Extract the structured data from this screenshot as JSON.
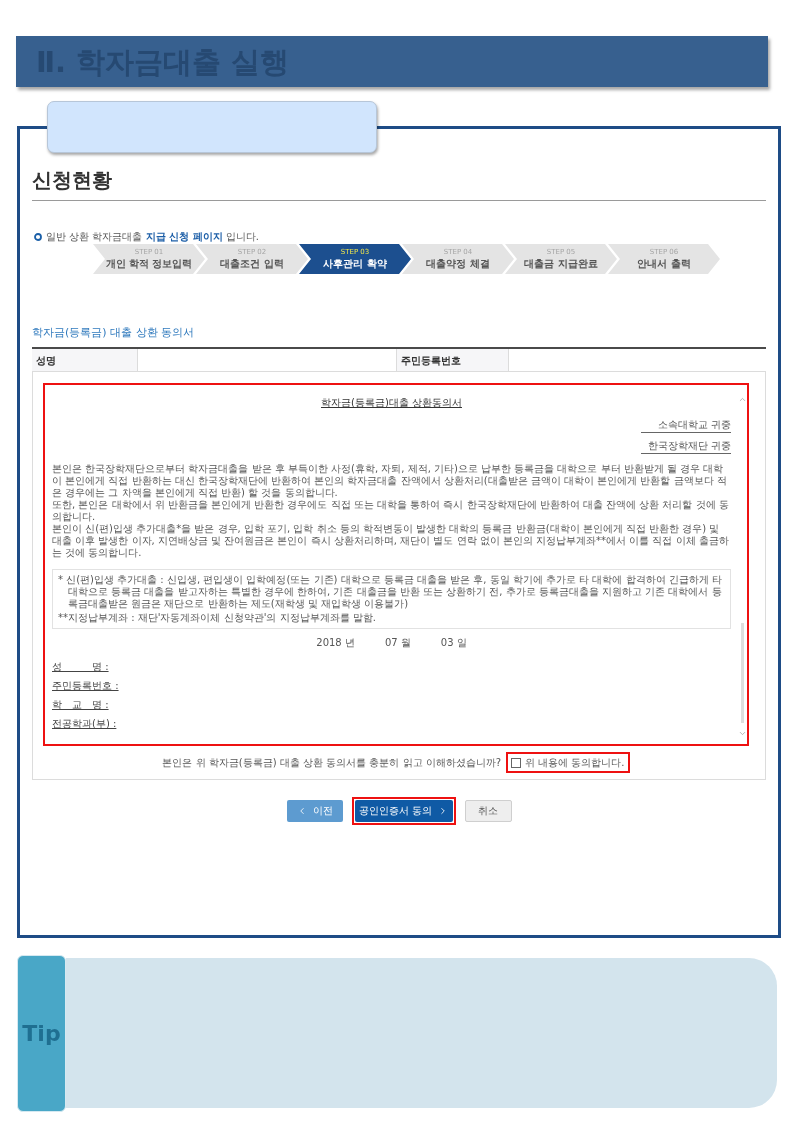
{
  "header": {
    "title": "Ⅱ. 학자금대출 실행"
  },
  "panel": {
    "heading": "신청현황",
    "notice": "일반 상환 학자금대출 **지급 신청 페이지** 입니다.",
    "steps": [
      {
        "step": "STEP 01",
        "label": "개인 학적 정보입력",
        "selected": false
      },
      {
        "step": "STEP 02",
        "label": "대출조건 입력",
        "selected": false
      },
      {
        "step": "STEP 03",
        "label": "사후관리 확약",
        "selected": true
      },
      {
        "step": "STEP 04",
        "label": "대출약정 체결",
        "selected": false
      },
      {
        "step": "STEP 05",
        "label": "대출금 지급완료",
        "selected": false
      },
      {
        "step": "STEP 06",
        "label": "안내서 출력",
        "selected": false
      }
    ],
    "section_title": "학자금(등록금) 대출 상환 동의서",
    "info_fields": [
      {
        "label": "성명"
      },
      {
        "label": "주민등록번호"
      }
    ],
    "document": {
      "highlighted": true,
      "title": "학자금(등록금)대출 상환동의서",
      "recipients": [
        "소속대학교 귀중",
        "한국장학재단 귀중"
      ],
      "paragraphs": [
        "본인은 한국장학재단으로부터 학자금대출을 받은 후 부득이한 사정(휴학, 자퇴, 제적, 기타)으로 납부한 등록금을 대학으로 부터 반환받게 될 경우 대학이 본인에게 직접 반환하는 대신 한국장학재단에 반환하여 본인의 학자금대출 잔액에서 상환처리(대출받은 금액이 대학이 본인에게 반환할 금액보다 적은 경우에는 그 차액을 본인에게 직접 반환) 할 것을 동의합니다.",
        "또한, 본인은 대학에서 위 반환금을 본인에게 반환한 경우에도 직접 또는 대학을 통하여 즉시 한국장학재단에 반환하여 대출 잔액에 상환 처리할 것에 동의합니다.",
        "본인이 신(편)입생 추가대출*을 받은 경우, 입학 포기, 입학 취소 등의 학적변동이 발생한 대학의 등록금 반환금(대학이 본인에게 직접 반환한 경우) 및 대출 이후 발생한 이자, 지연배상금 및 잔여원금은 본인이 즉시 상환처리하며, 재단이 별도 연락 없이 본인의 지정납부계좌**에서 이를 직접 이체 출금하는 것에 동의합니다."
      ],
      "notes": [
        "* 신(편)입생 추가대출 : 신입생, 편입생이 입학예정(또는 기존) 대학으로 등록금 대출을 받은 후, 동일 학기에 추가로 타 대학에 합격하여 긴급하게 타 대학으로 등록금 대출을 받고자하는 특별한 경우에 한하여, 기존 대출금을 반환 또는 상환하기 전, 추가로 등록금대출을 지원하고 기존 대학에서 등록금대출받은 원금은 재단으로 반환하는 제도(재학생 및 재입학생 이용불가)",
        "**지정납부계좌 : 재단'자동계좌이체 신청약관'의 지정납부계좌를 말함."
      ],
      "date": [
        "2018 년",
        "07 월",
        "03 일"
      ],
      "signature_fields": [
        "성　　　명 :",
        "주민등록번호 :",
        "학　교　명 :",
        "전공학과(부) :"
      ]
    },
    "consent": {
      "question": "본인은 위 학자금(등록금) 대출 상환 동의서를 충분히 읽고 이해하셨습니까?",
      "checkbox": {
        "label": "위 내용에 동의합니다.",
        "checked": false,
        "highlighted": true
      }
    },
    "buttons": [
      {
        "kind": "prev",
        "label": "이전",
        "highlighted": false
      },
      {
        "kind": "primary",
        "label": "공인인증서 동의",
        "highlighted": true
      },
      {
        "kind": "cancel",
        "label": "취소",
        "highlighted": false
      }
    ]
  },
  "tip": {
    "label": "Tip"
  }
}
